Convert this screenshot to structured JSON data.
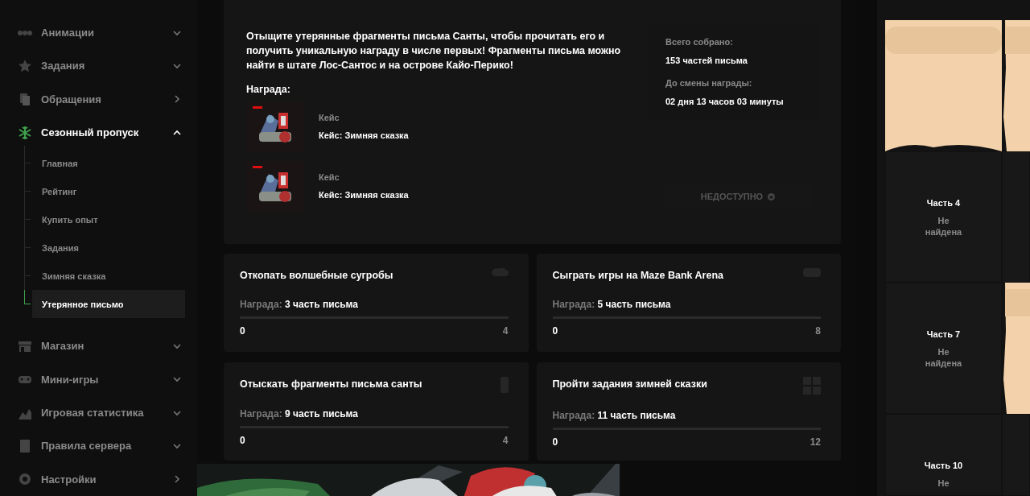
{
  "sidebar": {
    "items": [
      {
        "label": "Анимации",
        "kind": "anim",
        "has_submenu": true,
        "expanded": false,
        "active": false
      },
      {
        "label": "Задания",
        "kind": "star",
        "has_submenu": true,
        "expanded": false,
        "active": false
      },
      {
        "label": "Обращения",
        "kind": "docs",
        "has_submenu": false,
        "active": false
      },
      {
        "label": "Сезонный пропуск",
        "kind": "snow",
        "has_submenu": true,
        "expanded": true,
        "active": true,
        "children": [
          {
            "label": "Главная",
            "selected": false
          },
          {
            "label": "Рейтинг",
            "selected": false
          },
          {
            "label": "Купить опыт",
            "selected": false
          },
          {
            "label": "Задания",
            "selected": false
          },
          {
            "label": "Зимняя сказка",
            "selected": false
          },
          {
            "label": "Утерянное письмо",
            "selected": true
          }
        ]
      },
      {
        "label": "Магазин",
        "kind": "shop",
        "has_submenu": true,
        "expanded": false,
        "active": false
      },
      {
        "label": "Мини-игры",
        "kind": "pad",
        "has_submenu": true,
        "expanded": false,
        "active": false
      },
      {
        "label": "Игровая статистика",
        "kind": "chart",
        "has_submenu": true,
        "expanded": false,
        "active": false
      },
      {
        "label": "Правила сервера",
        "kind": "doc",
        "has_submenu": true,
        "expanded": false,
        "active": false
      },
      {
        "label": "Настройки",
        "kind": "gear",
        "has_submenu": false,
        "active": false
      }
    ]
  },
  "intro": {
    "description": "Отыщите утерянные фрагменты письма Санты, чтобы прочитать его и получить уникальную награду в числе первых! Фрагменты письма можно найти в штате Лос-Сантос и на острове Кайо-Перико!",
    "reward_heading": "Награда:",
    "rewards": [
      {
        "type": "Кейс",
        "name": "Кейс: Зимняя сказка"
      },
      {
        "type": "Кейс",
        "name": "Кейс: Зимняя сказка"
      }
    ],
    "stats": [
      {
        "label": "Всего собрано:",
        "value": "153 частей письма"
      },
      {
        "label": "До смены награды:",
        "value": "02 дня 13 часов 03 минуты"
      }
    ],
    "claim_button": {
      "label": "НЕДОСТУПНО",
      "disabled": true
    }
  },
  "tasks": [
    {
      "title": "Откопать волшебные сугробы",
      "kind": "cloud",
      "reward_label": "Награда:",
      "reward": "3 часть письма",
      "current": "0",
      "total": "4",
      "level": 0
    },
    {
      "title": "Сыграть игры на Maze Bank Arena",
      "kind": "pad",
      "reward_label": "Награда:",
      "reward": "5 часть письма",
      "current": "0",
      "total": "8",
      "level": 0
    },
    {
      "title": "Отыскать фрагменты письма санты",
      "kind": "phone",
      "reward_label": "Награда:",
      "reward": "9 часть письма",
      "current": "0",
      "total": "4",
      "level": 0
    },
    {
      "title": "Пройти задания зимней сказки",
      "kind": "grid",
      "reward_label": "Награда:",
      "reward": "11 часть письма",
      "current": "0",
      "total": "12",
      "level": 0
    }
  ],
  "letter_parts": [
    {
      "kind": "found"
    },
    {
      "kind": "found"
    },
    {
      "kind": "missing",
      "title": "Часть 4",
      "status": "Не найдена"
    },
    {
      "kind": "missing"
    },
    {
      "kind": "missing",
      "title": "Часть 7",
      "status": "Не найдена"
    },
    {
      "kind": "found"
    },
    {
      "kind": "missing",
      "title": "Часть 10",
      "status": "Не"
    },
    {
      "kind": "missing"
    }
  ]
}
